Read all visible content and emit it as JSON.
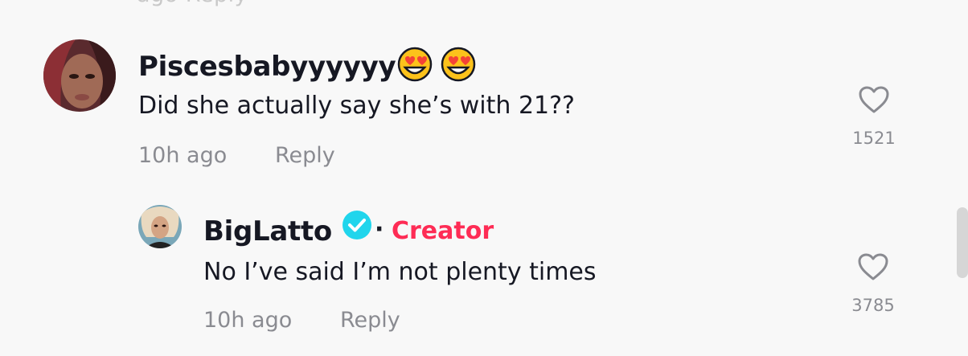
{
  "cut_text": "ago   Reply",
  "comments": [
    {
      "author": "Piscesbabyyyyyy",
      "author_emojis": [
        "heart-eyes-emoji",
        "heart-eyes-emoji"
      ],
      "text": "Did she actually say she’s with 21??",
      "time": "10h ago",
      "reply_label": "Reply",
      "likes": "1521"
    }
  ],
  "reply": {
    "author": "BigLatto",
    "verified": true,
    "separator": "·",
    "badge": "Creator",
    "text": "No I’ve said I’m not plenty times",
    "time": "10h ago",
    "reply_label": "Reply",
    "likes": "3785"
  },
  "colors": {
    "background": "#f8f8f8",
    "primary_text": "#161823",
    "secondary_text": "#8a8b91",
    "creator_badge": "#fe2c55",
    "verified_badge": "#20d5ec"
  }
}
